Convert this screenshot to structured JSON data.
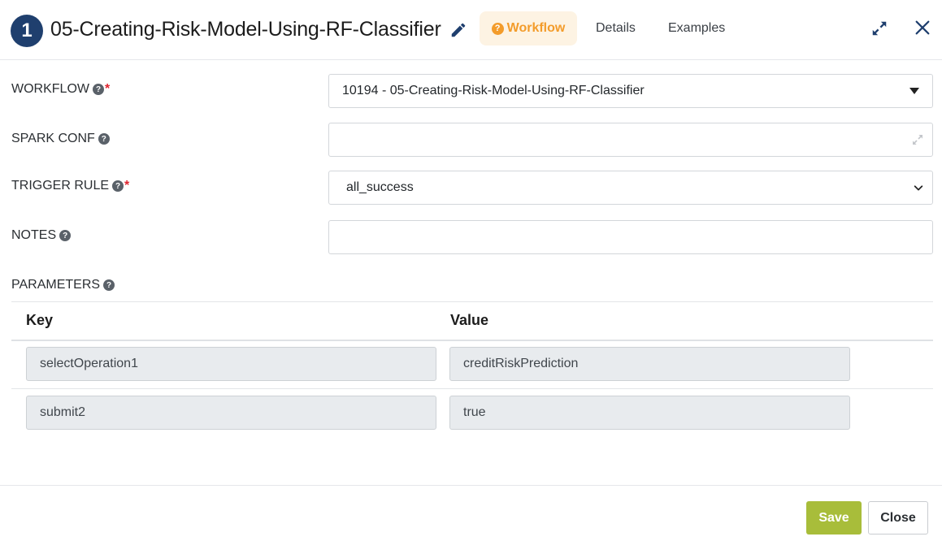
{
  "header": {
    "step_number": "1",
    "title": "05-Creating-Risk-Model-Using-RF-Classifier",
    "tabs": {
      "workflow": "Workflow",
      "details": "Details",
      "examples": "Examples"
    },
    "active_tab": "Workflow",
    "accent_color": "#f39c2b",
    "badge_color": "#1f3f6e"
  },
  "form": {
    "workflow": {
      "label": "WORKFLOW",
      "required": "*",
      "value": "10194 - 05-Creating-Risk-Model-Using-RF-Classifier"
    },
    "spark_conf": {
      "label": "SPARK CONF",
      "value": ""
    },
    "trigger_rule": {
      "label": "TRIGGER RULE",
      "required": "*",
      "value": "all_success"
    },
    "notes": {
      "label": "NOTES",
      "value": ""
    }
  },
  "parameters": {
    "label": "PARAMETERS",
    "columns": {
      "key": "Key",
      "value": "Value"
    },
    "rows": [
      {
        "key": "selectOperation1",
        "value": "creditRiskPrediction"
      },
      {
        "key": "submit2",
        "value": "true"
      }
    ]
  },
  "footer": {
    "save_label": "Save",
    "close_label": "Close",
    "save_color": "#a8bd3a"
  }
}
